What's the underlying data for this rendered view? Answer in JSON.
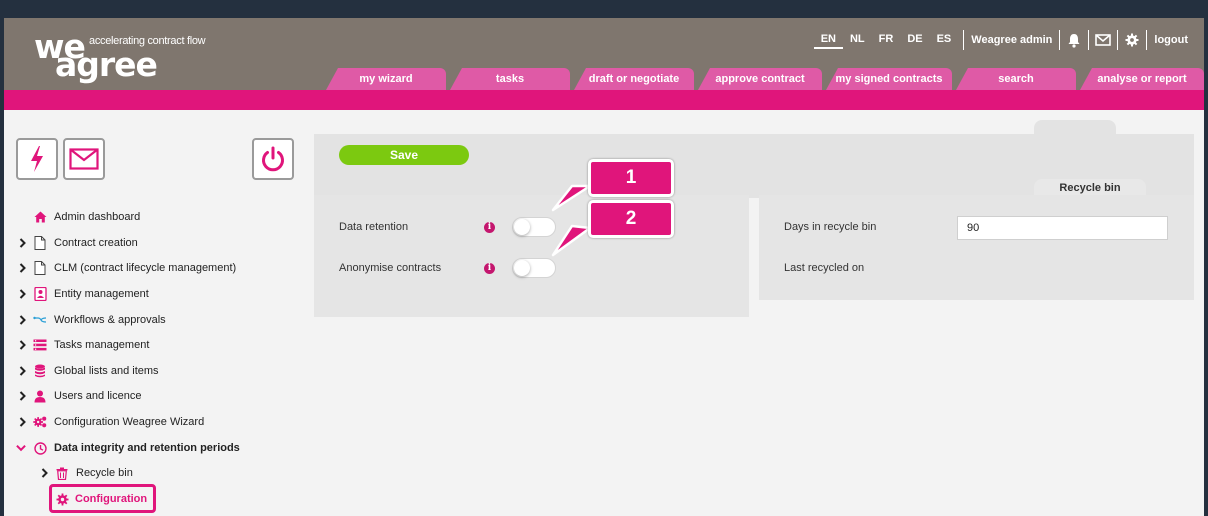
{
  "brand": {
    "logo_top": "we",
    "logo_bottom": "agree",
    "tagline": "accelerating contract flow"
  },
  "topbar": {
    "languages": [
      "EN",
      "NL",
      "FR",
      "DE",
      "ES"
    ],
    "active_language": "EN",
    "user": "Weagree admin",
    "logout": "logout",
    "icons": [
      "bell-icon",
      "envelope-icon",
      "gear-icon"
    ]
  },
  "nav_tabs": [
    "my wizard",
    "tasks",
    "draft or negotiate",
    "approve contract",
    "my signed contracts",
    "search",
    "analyse or report"
  ],
  "quick_buttons": {
    "flash": "lightning-icon",
    "mail": "envelope-icon",
    "power": "power-icon"
  },
  "sidebar": {
    "items": [
      {
        "label": "Admin dashboard",
        "icon": "home-icon"
      },
      {
        "label": "Contract creation",
        "icon": "document-icon"
      },
      {
        "label": "CLM (contract lifecycle management)",
        "icon": "document-icon"
      },
      {
        "label": "Entity management",
        "icon": "contact-card-icon"
      },
      {
        "label": "Workflows & approvals",
        "icon": "workflow-icon"
      },
      {
        "label": "Tasks management",
        "icon": "task-list-icon"
      },
      {
        "label": "Global lists and items",
        "icon": "database-icon"
      },
      {
        "label": "Users and licence",
        "icon": "user-icon"
      },
      {
        "label": "Configuration Weagree Wizard",
        "icon": "gears-icon"
      },
      {
        "label": "Data integrity and retention periods",
        "icon": "clock-icon"
      },
      {
        "label": "Recycle bin",
        "icon": "trash-icon"
      },
      {
        "label": "Configuration",
        "icon": "gear-icon"
      }
    ]
  },
  "toolbar": {
    "save_label": "Save"
  },
  "settings": {
    "data_retention_label": "Data retention",
    "data_retention_on": false,
    "anonymise_label": "Anonymise contracts",
    "anonymise_on": false,
    "info_glyph": "i"
  },
  "recycle_bin": {
    "tab_label": "Recycle bin",
    "days_label": "Days in recycle bin",
    "days_value": "90",
    "last_recycled_label": "Last recycled on"
  },
  "callouts": [
    "1",
    "2"
  ],
  "colors": {
    "header": "#7f766e",
    "accent": "#e0157b",
    "tab": "#df5aa6",
    "save": "#7cc910",
    "panel": "#e5e5e5"
  }
}
